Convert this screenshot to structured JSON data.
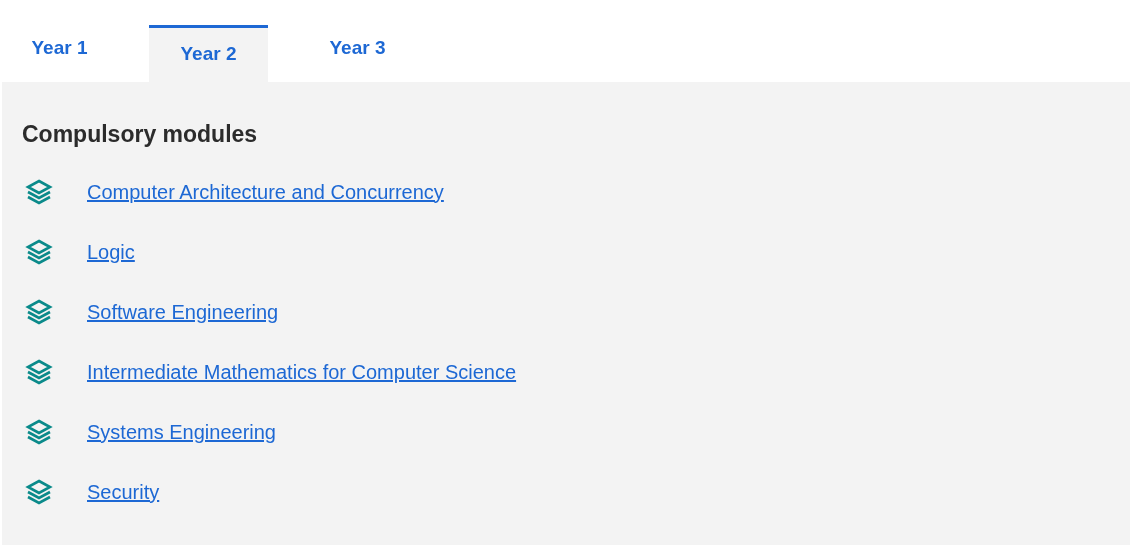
{
  "tabs": [
    {
      "label": "Year 1",
      "selected": false
    },
    {
      "label": "Year 2",
      "selected": true
    },
    {
      "label": "Year 3",
      "selected": false
    }
  ],
  "panel": {
    "heading": "Compulsory modules",
    "modules": [
      {
        "name": "Computer Architecture and Concurrency"
      },
      {
        "name": "Logic"
      },
      {
        "name": "Software Engineering"
      },
      {
        "name": "Intermediate Mathematics for Computer Science"
      },
      {
        "name": "Systems Engineering"
      },
      {
        "name": "Security"
      }
    ]
  }
}
